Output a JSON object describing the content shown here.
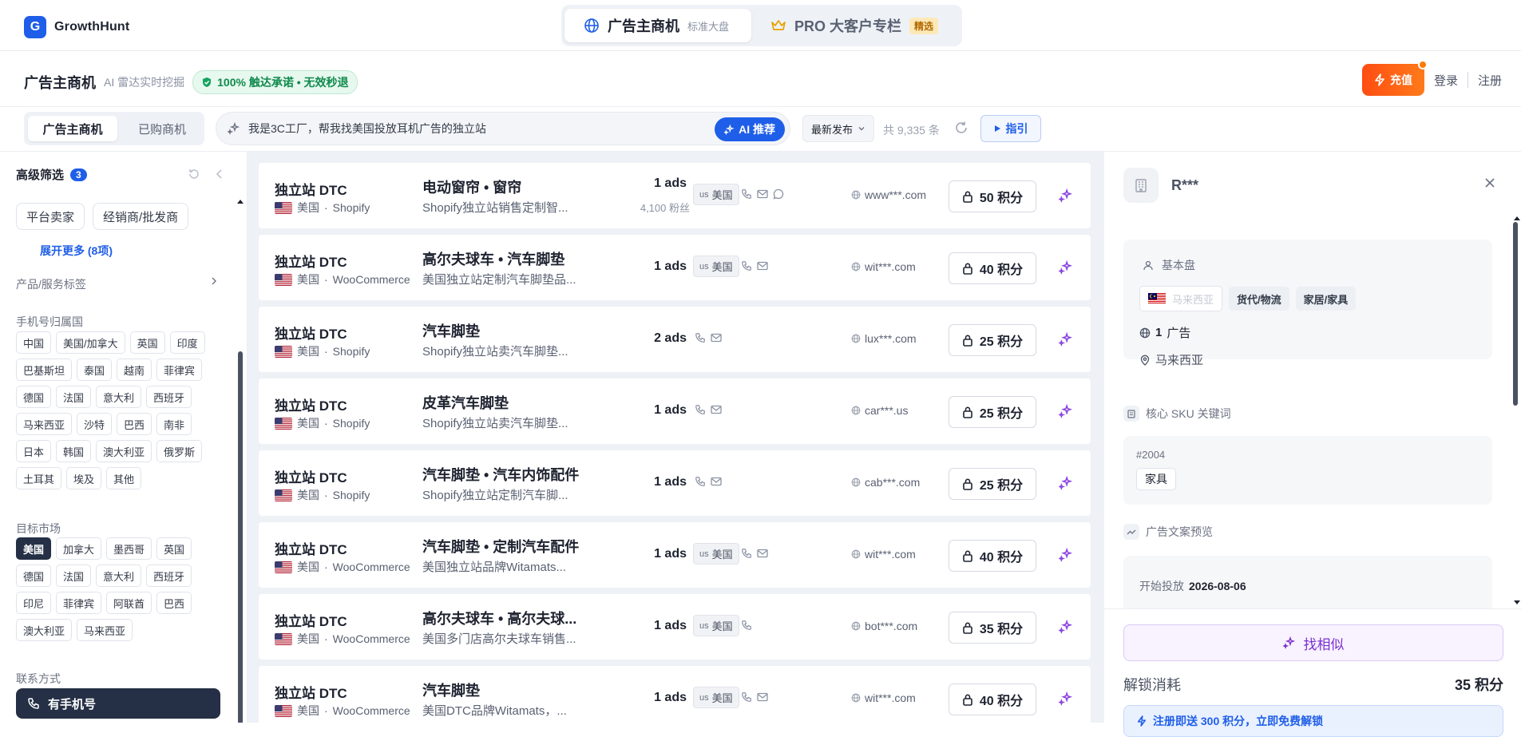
{
  "brand": {
    "logo_letter": "G",
    "name": "GrowthHunt",
    "color": "#1f5ee8"
  },
  "top_tabs": [
    {
      "label": "广告主商机",
      "sub": "标准大盘"
    },
    {
      "label": "PRO 大客户专栏",
      "badge": "精选"
    }
  ],
  "header": {
    "title": "广告主商机",
    "subtitle": "AI 雷达实时挖掘",
    "promise": "100% 触达承诺 • 无效秒退"
  },
  "actions": {
    "charge": "充值",
    "login": "登录",
    "register": "注册"
  },
  "subtabs": [
    "广告主商机",
    "已购商机"
  ],
  "search": {
    "value": "我是3C工厂，帮我找美国投放耳机广告的独立站",
    "ai_button": "AI 推荐"
  },
  "sort": {
    "selected": "最新发布"
  },
  "total": "共 9,335 条",
  "guide": "指引",
  "sidebar": {
    "title": "高级筛选",
    "badge": "3",
    "merchant_chips": [
      "平台卖家",
      "经销商/批发商"
    ],
    "expand_more": "展开更多 (8项)",
    "tags_label": "产品/服务标签",
    "phone_label": "手机号归属国",
    "phone_countries": [
      "中国",
      "美国/加拿大",
      "英国",
      "印度",
      "巴基斯坦",
      "泰国",
      "越南",
      "菲律宾",
      "德国",
      "法国",
      "意大利",
      "西班牙",
      "马来西亚",
      "沙特",
      "巴西",
      "南非",
      "日本",
      "韩国",
      "澳大利亚",
      "俄罗斯",
      "土耳其",
      "埃及",
      "其他"
    ],
    "market_label": "目标市场",
    "markets": [
      "美国",
      "加拿大",
      "墨西哥",
      "英国",
      "德国",
      "法国",
      "意大利",
      "西班牙",
      "印尼",
      "菲律宾",
      "阿联酋",
      "巴西",
      "澳大利亚",
      "马来西亚"
    ],
    "market_selected": "美国",
    "contact_label": "联系方式",
    "contact_option": "有手机号"
  },
  "listings": [
    {
      "type": "独立站 DTC",
      "country": "美国",
      "platform": "Shopify",
      "title": "电动窗帘 • 窗帘",
      "desc": "Shopify独立站销售定制智...",
      "ads": "1 ads",
      "fans": "4,100 粉丝",
      "loc": "美国",
      "loc_code": "us",
      "contacts": [
        "phone",
        "mail",
        "chat"
      ],
      "domain": "www***.com",
      "price": "50 积分"
    },
    {
      "type": "独立站 DTC",
      "country": "美国",
      "platform": "WooCommerce",
      "title": "高尔夫球车 • 汽车脚垫",
      "desc": "美国独立站定制汽车脚垫品...",
      "ads": "1 ads",
      "fans": "",
      "loc": "美国",
      "loc_code": "us",
      "contacts": [
        "phone",
        "mail"
      ],
      "domain": "wit***.com",
      "price": "40 积分"
    },
    {
      "type": "独立站 DTC",
      "country": "美国",
      "platform": "Shopify",
      "title": "汽车脚垫",
      "desc": "Shopify独立站卖汽车脚垫...",
      "ads": "2 ads",
      "fans": "",
      "loc": "",
      "loc_code": "",
      "contacts": [
        "phone",
        "mail"
      ],
      "domain": "lux***.com",
      "price": "25 积分"
    },
    {
      "type": "独立站 DTC",
      "country": "美国",
      "platform": "Shopify",
      "title": "皮革汽车脚垫",
      "desc": "Shopify独立站卖汽车脚垫...",
      "ads": "1 ads",
      "fans": "",
      "loc": "",
      "loc_code": "",
      "contacts": [
        "phone",
        "mail"
      ],
      "domain": "car***.us",
      "price": "25 积分"
    },
    {
      "type": "独立站 DTC",
      "country": "美国",
      "platform": "Shopify",
      "title": "汽车脚垫 • 汽车内饰配件",
      "desc": "Shopify独立站定制汽车脚...",
      "ads": "1 ads",
      "fans": "",
      "loc": "",
      "loc_code": "",
      "contacts": [
        "phone",
        "mail"
      ],
      "domain": "cab***.com",
      "price": "25 积分"
    },
    {
      "type": "独立站 DTC",
      "country": "美国",
      "platform": "WooCommerce",
      "title": "汽车脚垫 • 定制汽车配件",
      "desc": "美国独立站品牌Witamats...",
      "ads": "1 ads",
      "fans": "",
      "loc": "美国",
      "loc_code": "us",
      "contacts": [
        "phone",
        "mail"
      ],
      "domain": "wit***.com",
      "price": "40 积分"
    },
    {
      "type": "独立站 DTC",
      "country": "美国",
      "platform": "WooCommerce",
      "title": "高尔夫球车 • 高尔夫球...",
      "desc": "美国多门店高尔夫球车销售...",
      "ads": "1 ads",
      "fans": "",
      "loc": "美国",
      "loc_code": "us",
      "contacts": [
        "phone"
      ],
      "domain": "bot***.com",
      "price": "35 积分"
    },
    {
      "type": "独立站 DTC",
      "country": "美国",
      "platform": "WooCommerce",
      "title": "汽车脚垫",
      "desc": "美国DTC品牌Witamats，...",
      "ads": "1 ads",
      "fans": "",
      "loc": "美国",
      "loc_code": "us",
      "contacts": [
        "phone",
        "mail"
      ],
      "domain": "wit***.com",
      "price": "40 积分"
    }
  ],
  "detail": {
    "name": "R***",
    "basic_label": "基本盘",
    "country_tag": "马来西亚",
    "industry_tags": [
      "货代/物流",
      "家居/家具"
    ],
    "ads_count": "1",
    "ads_unit": "广告",
    "location": "马来西亚",
    "sku_label": "核心 SKU 关键词",
    "sku_id": "#2004",
    "sku_tag": "家具",
    "copy_label": "广告文案预览",
    "start_label": "开始投放",
    "start_date": "2026-08-06",
    "find_similar": "找相似",
    "unlock_label": "解锁消耗",
    "unlock_cost": "35 积分",
    "register_offer": "注册即送 300 积分，立即免费解锁"
  }
}
